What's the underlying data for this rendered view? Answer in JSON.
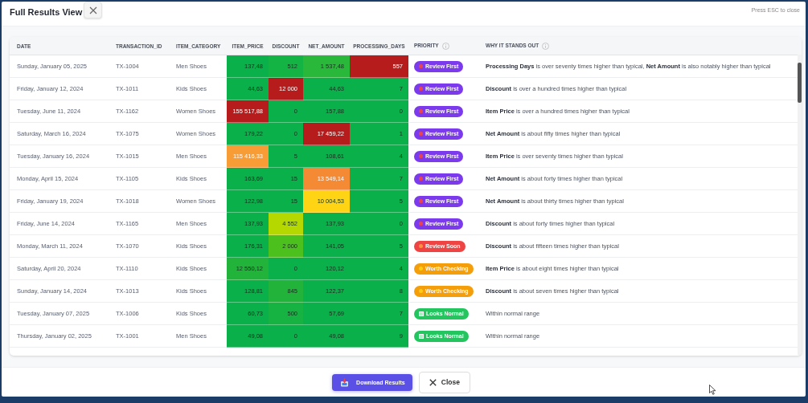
{
  "modal": {
    "title": "Full Results View",
    "hint": "Press ESC to close"
  },
  "table": {
    "columns": [
      {
        "label": "DATE",
        "info": false
      },
      {
        "label": "TRANSACTION_ID",
        "info": false
      },
      {
        "label": "ITEM_CATEGORY",
        "info": false
      },
      {
        "label": "ITEM_PRICE",
        "info": false
      },
      {
        "label": "DISCOUNT",
        "info": false
      },
      {
        "label": "NET_AMOUNT",
        "info": false
      },
      {
        "label": "PROCESSING_DAYS",
        "info": false
      },
      {
        "label": "PRIORITY",
        "info": true
      },
      {
        "label": "WHY IT STANDS OUT",
        "info": true
      }
    ],
    "rows": [
      {
        "date": "Sunday, January 05, 2025",
        "id": "TX-1004",
        "category": "Men Shoes",
        "metrics": [
          {
            "value": "137,48",
            "color": "#0ab04a"
          },
          {
            "value": "512",
            "color": "#14b444"
          },
          {
            "value": "1 537,48",
            "color": "#29b83a"
          },
          {
            "value": "557",
            "color": "#b71c1c"
          }
        ],
        "priority": {
          "kind": "review_first",
          "label": "Review First"
        },
        "reason": "**Processing Days** is over seventy times higher than typical, **Net Amount** is also notably higher than typical"
      },
      {
        "date": "Friday, January 12, 2024",
        "id": "TX-1011",
        "category": "Kids Shoes",
        "metrics": [
          {
            "value": "44,63",
            "color": "#0ab04a"
          },
          {
            "value": "12 000",
            "color": "#b71c1c"
          },
          {
            "value": "44,63",
            "color": "#0ab04a"
          },
          {
            "value": "7",
            "color": "#0ab04a"
          }
        ],
        "priority": {
          "kind": "review_first",
          "label": "Review First"
        },
        "reason": "**Discount** is over a hundred times higher than typical"
      },
      {
        "date": "Tuesday, June 11, 2024",
        "id": "TX-1162",
        "category": "Women Shoes",
        "metrics": [
          {
            "value": "155 517,88",
            "color": "#b71c1c"
          },
          {
            "value": "0",
            "color": "#0ab04a"
          },
          {
            "value": "157,88",
            "color": "#0ab04a"
          },
          {
            "value": "0",
            "color": "#0ab04a"
          }
        ],
        "priority": {
          "kind": "review_first",
          "label": "Review First"
        },
        "reason": "**Item Price** is over a hundred times higher than typical"
      },
      {
        "date": "Saturday, March 16, 2024",
        "id": "TX-1075",
        "category": "Women Shoes",
        "metrics": [
          {
            "value": "179,22",
            "color": "#0ab04a"
          },
          {
            "value": "0",
            "color": "#0ab04a"
          },
          {
            "value": "17 459,22",
            "color": "#b71c1c"
          },
          {
            "value": "1",
            "color": "#0ab04a"
          }
        ],
        "priority": {
          "kind": "review_first",
          "label": "Review First"
        },
        "reason": "**Net Amount** is about fifty times higher than typical"
      },
      {
        "date": "Tuesday, January 16, 2024",
        "id": "TX-1015",
        "category": "Men Shoes",
        "metrics": [
          {
            "value": "115 416,33",
            "color": "#f89c36"
          },
          {
            "value": "5",
            "color": "#0ab04a"
          },
          {
            "value": "108,61",
            "color": "#0ab04a"
          },
          {
            "value": "4",
            "color": "#0ab04a"
          }
        ],
        "priority": {
          "kind": "review_first",
          "label": "Review First"
        },
        "reason": "**Item Price** is over seventy times higher than typical"
      },
      {
        "date": "Monday, April 15, 2024",
        "id": "TX-1105",
        "category": "Kids Shoes",
        "metrics": [
          {
            "value": "163,69",
            "color": "#0ab04a"
          },
          {
            "value": "15",
            "color": "#0ab04a"
          },
          {
            "value": "13 549,14",
            "color": "#f58a35"
          },
          {
            "value": "7",
            "color": "#0ab04a"
          }
        ],
        "priority": {
          "kind": "review_first",
          "label": "Review First"
        },
        "reason": "**Net Amount** is about forty times higher than typical"
      },
      {
        "date": "Friday, January 19, 2024",
        "id": "TX-1018",
        "category": "Women Shoes",
        "metrics": [
          {
            "value": "122,98",
            "color": "#0ab04a"
          },
          {
            "value": "15",
            "color": "#0ab04a"
          },
          {
            "value": "10 004,53",
            "color": "#ffd414"
          },
          {
            "value": "5",
            "color": "#0ab04a"
          }
        ],
        "priority": {
          "kind": "review_first",
          "label": "Review First"
        },
        "reason": "**Net Amount** is about thirty times higher than typical"
      },
      {
        "date": "Friday, June 14, 2024",
        "id": "TX-1165",
        "category": "Men Shoes",
        "metrics": [
          {
            "value": "137,93",
            "color": "#0ab04a"
          },
          {
            "value": "4 552",
            "color": "#b5d900"
          },
          {
            "value": "137,93",
            "color": "#0ab04a"
          },
          {
            "value": "0",
            "color": "#0ab04a"
          }
        ],
        "priority": {
          "kind": "review_first",
          "label": "Review First"
        },
        "reason": "**Discount** is about forty times higher than typical"
      },
      {
        "date": "Monday, March 11, 2024",
        "id": "TX-1070",
        "category": "Kids Shoes",
        "metrics": [
          {
            "value": "176,31",
            "color": "#0ab04a"
          },
          {
            "value": "2 000",
            "color": "#4cc01c"
          },
          {
            "value": "141,05",
            "color": "#0ab04a"
          },
          {
            "value": "5",
            "color": "#0ab04a"
          }
        ],
        "priority": {
          "kind": "review_soon",
          "label": "Review Soon"
        },
        "reason": "**Discount** is about fifteen times higher than typical"
      },
      {
        "date": "Saturday, April 20, 2024",
        "id": "TX-1110",
        "category": "Kids Shoes",
        "metrics": [
          {
            "value": "12 550,12",
            "color": "#22b33a"
          },
          {
            "value": "0",
            "color": "#0ab04a"
          },
          {
            "value": "120,12",
            "color": "#0ab04a"
          },
          {
            "value": "4",
            "color": "#0ab04a"
          }
        ],
        "priority": {
          "kind": "worth_checking",
          "label": "Worth Checking"
        },
        "reason": "**Item Price** is about eight times higher than typical"
      },
      {
        "date": "Sunday, January 14, 2024",
        "id": "TX-1013",
        "category": "Kids Shoes",
        "metrics": [
          {
            "value": "128,81",
            "color": "#0ab04a"
          },
          {
            "value": "845",
            "color": "#22b33a"
          },
          {
            "value": "122,37",
            "color": "#0ab04a"
          },
          {
            "value": "8",
            "color": "#0ab04a"
          }
        ],
        "priority": {
          "kind": "worth_checking",
          "label": "Worth Checking"
        },
        "reason": "**Discount** is about seven times higher than typical"
      },
      {
        "date": "Tuesday, January 07, 2025",
        "id": "TX-1006",
        "category": "Kids Shoes",
        "metrics": [
          {
            "value": "60,73",
            "color": "#0ab04a"
          },
          {
            "value": "500",
            "color": "#16b342"
          },
          {
            "value": "57,69",
            "color": "#0ab04a"
          },
          {
            "value": "7",
            "color": "#0ab04a"
          }
        ],
        "priority": {
          "kind": "looks_normal",
          "label": "Looks Normal"
        },
        "reason": "Within normal range"
      },
      {
        "date": "Thursday, January 02, 2025",
        "id": "TX-1001",
        "category": "Men Shoes",
        "metrics": [
          {
            "value": "49,08",
            "color": "#0ab04a"
          },
          {
            "value": "0",
            "color": "#0ab04a"
          },
          {
            "value": "49,08",
            "color": "#0ab04a"
          },
          {
            "value": "9",
            "color": "#0ab04a"
          }
        ],
        "priority": {
          "kind": "looks_normal",
          "label": "Looks Normal"
        },
        "reason": "Within normal range"
      }
    ]
  },
  "footer": {
    "buttons": [
      {
        "kind": "primary",
        "label": "Download Results"
      },
      {
        "kind": "secondary",
        "label": "Close"
      }
    ]
  }
}
